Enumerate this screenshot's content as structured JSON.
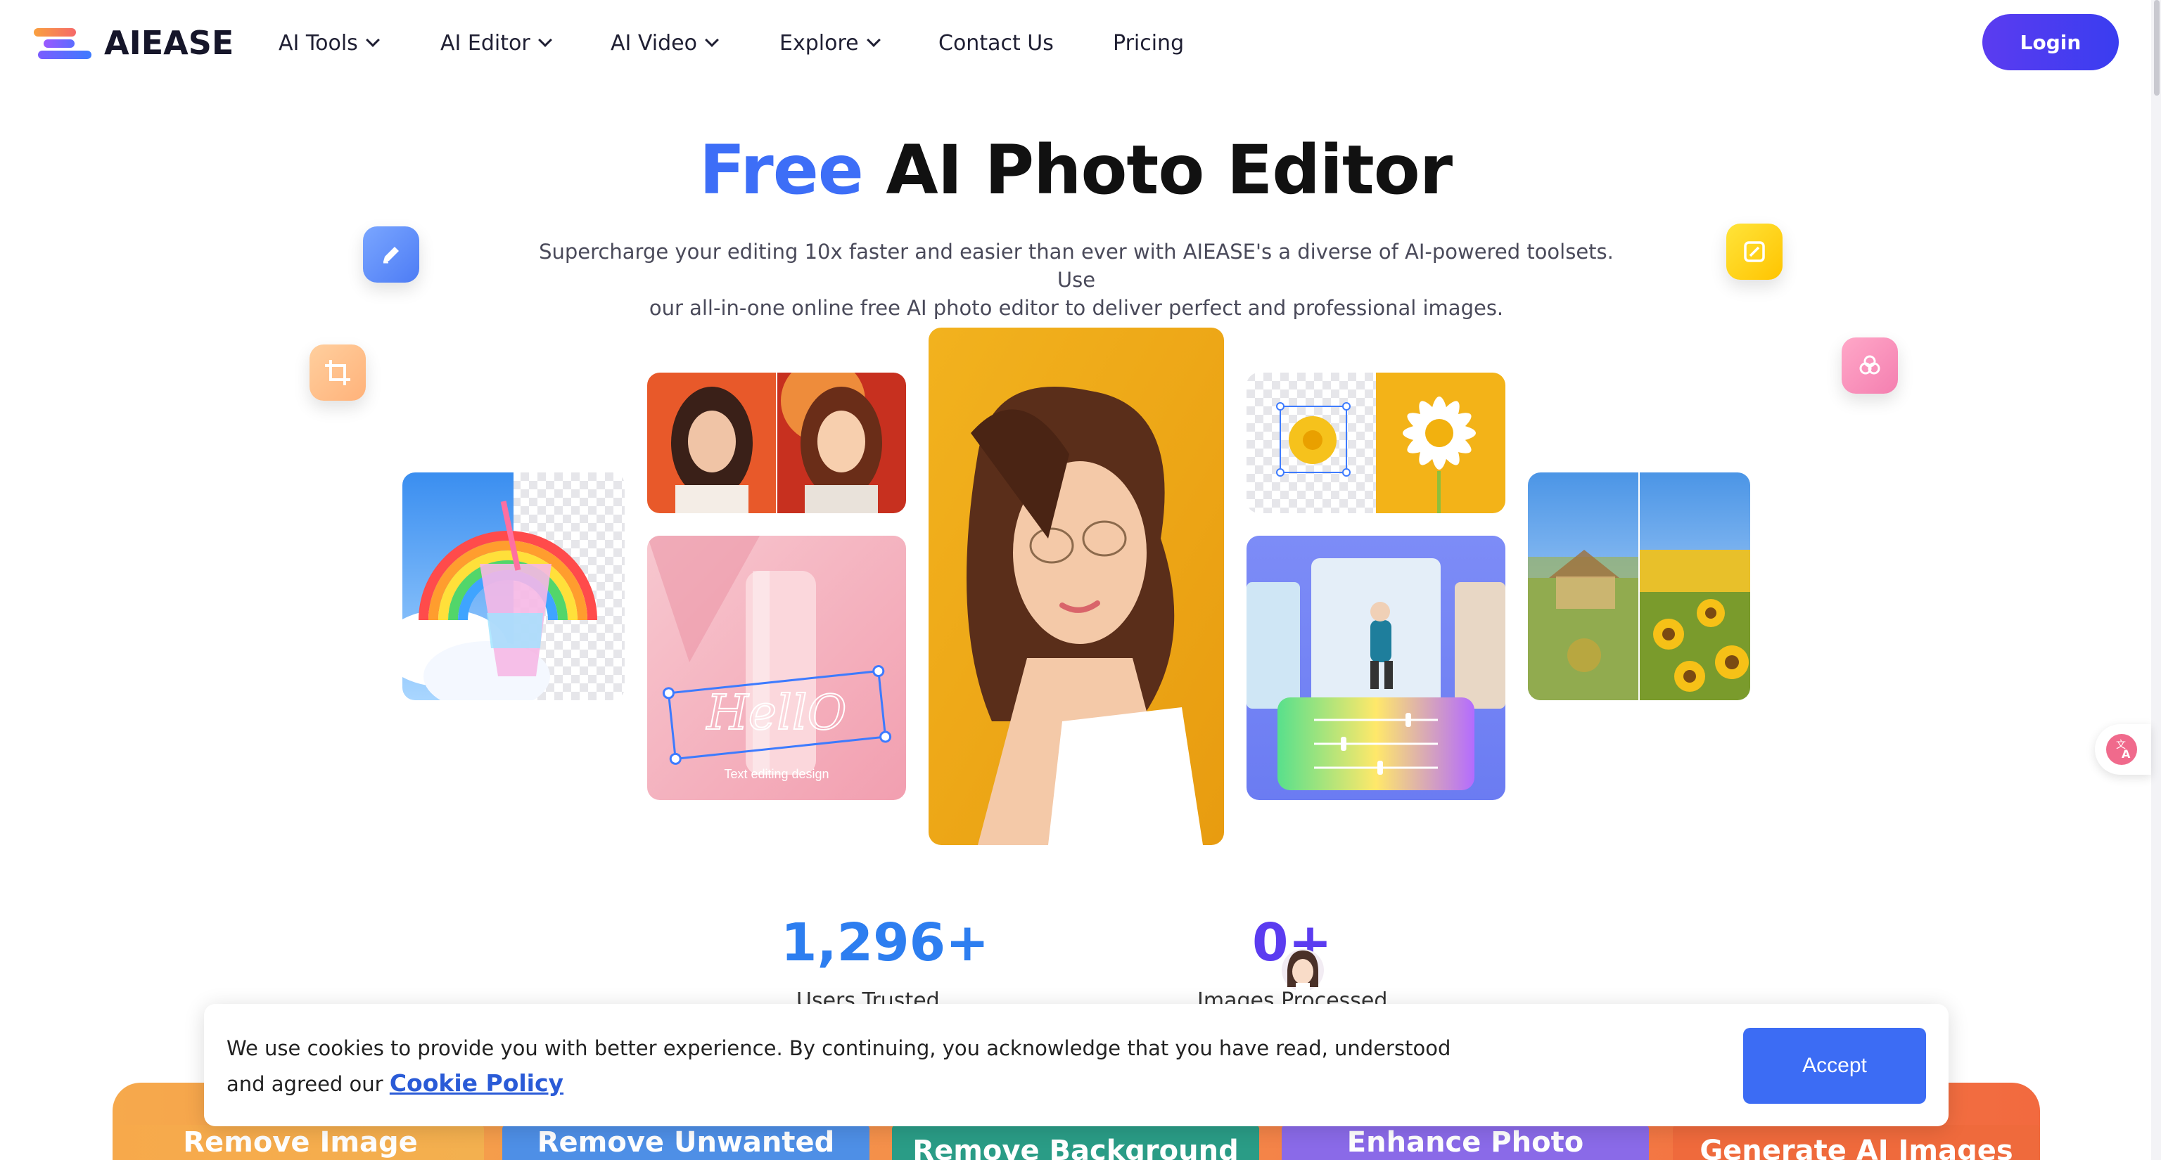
{
  "brand": {
    "name": "AIEASE"
  },
  "nav": {
    "items": [
      {
        "label": "AI Tools",
        "has_dropdown": true
      },
      {
        "label": "AI Editor",
        "has_dropdown": true
      },
      {
        "label": "AI Video",
        "has_dropdown": true
      },
      {
        "label": "Explore",
        "has_dropdown": true
      },
      {
        "label": "Contact Us",
        "has_dropdown": false
      },
      {
        "label": "Pricing",
        "has_dropdown": false
      }
    ],
    "login_label": "Login"
  },
  "hero": {
    "title_accent": "Free",
    "title_rest": "AI Photo Editor",
    "subtitle_line1": "Supercharge your editing 10x faster and easier than ever with AIEASE's a diverse of AI-powered toolsets. Use",
    "subtitle_line2": "our all-in-one online free AI photo editor to deliver perfect and professional images.",
    "floating_icons": [
      "pencil-icon",
      "crop-icon",
      "edit-square-icon",
      "color-circles-icon"
    ],
    "text_tile_script": "HellO",
    "text_tile_caption": "Text editing design"
  },
  "stats": [
    {
      "value": "1,296+",
      "label": "Users Trusted"
    },
    {
      "value": "0+",
      "label": "Images Processed"
    }
  ],
  "feature_cards": [
    {
      "label": "Remove Image"
    },
    {
      "label": "Remove Unwanted"
    },
    {
      "label": "Remove Background"
    },
    {
      "label": "Enhance Photo"
    },
    {
      "label": "Generate AI Images"
    }
  ],
  "cookie": {
    "text_line1": "We use cookies to provide you with better experience. By continuing, you acknowledge that you have read, understood",
    "text_prefix_line2": "and agreed our",
    "link_label": "Cookie Policy",
    "accept_label": "Accept"
  },
  "colors": {
    "accent_blue": "#3d6ef7",
    "login_purple": "#4a3cf0",
    "stat_blue": "#2d7ef0",
    "stat_purple": "#5b3cf0",
    "accept_blue": "#3c6cf4"
  }
}
